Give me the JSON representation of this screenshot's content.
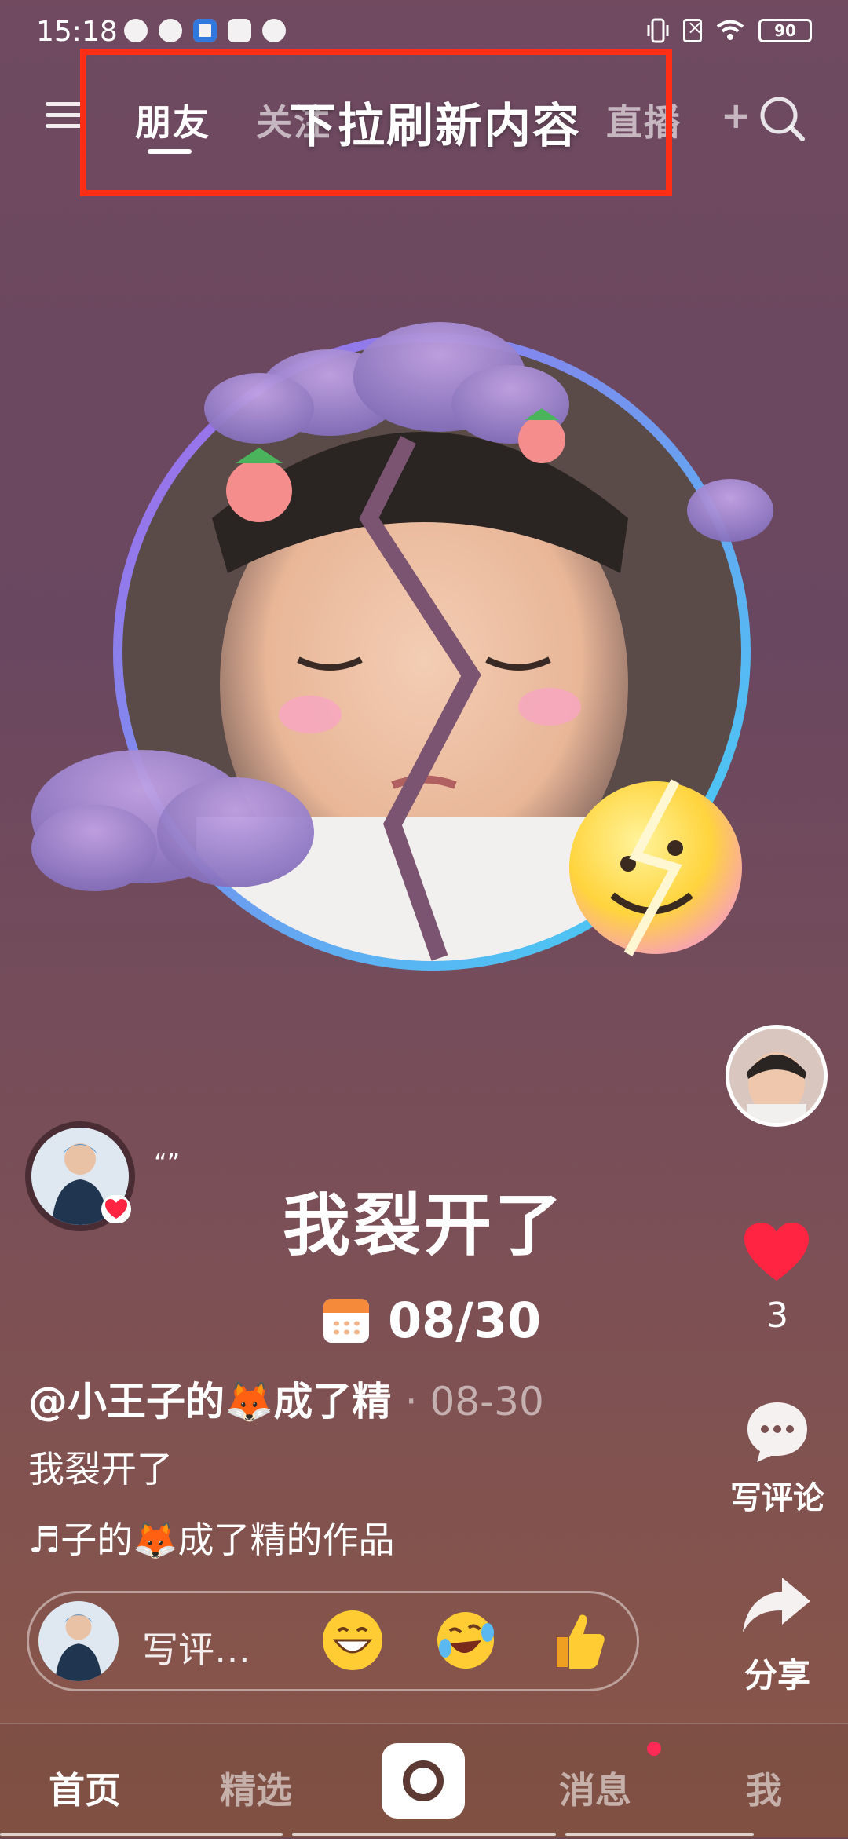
{
  "status_bar": {
    "time": "15:18",
    "battery": "90"
  },
  "top_nav": {
    "tabs": [
      {
        "label": "朋友",
        "active": true
      },
      {
        "label": "关注",
        "active": false
      },
      {
        "label": "直播",
        "active": false
      },
      {
        "label": "+",
        "active": false
      }
    ],
    "refresh_hint": "下拉刷新内容",
    "highlight_color": "#ff2e14"
  },
  "post": {
    "quote": "“”",
    "big_caption": "我裂开了",
    "date": "08/30",
    "author": "@小王子的🦊成了精",
    "separator": "·",
    "posted_time": "08-30",
    "description": "我裂开了",
    "music": "♬子的🦊成了精的作品"
  },
  "right_rail": {
    "like_count": "3",
    "comment_label": "写评论",
    "share_label": "分享"
  },
  "comment_bar": {
    "placeholder": "写评…",
    "emojis": [
      "grin-emoji",
      "laugh-cry-emoji",
      "thumbs-up-emoji"
    ]
  },
  "bottom_nav": {
    "items": [
      "首页",
      "精选",
      "消息",
      "我"
    ]
  }
}
